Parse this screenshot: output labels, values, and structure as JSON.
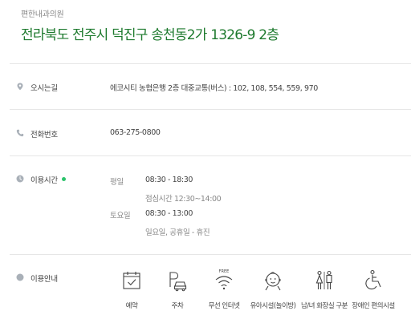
{
  "header": {
    "place_name": "편한내과의원",
    "address": "전라북도 전주시 덕진구 송천동2가 1326-9 2층"
  },
  "directions": {
    "label": "오시는길",
    "value": "에코시티 농협은행 2층 대중교통(버스) : 102, 108, 554, 559, 970"
  },
  "phone": {
    "label": "전화번호",
    "value": "063-275-0800"
  },
  "hours": {
    "label": "이용시간",
    "status_color": "#2bc36b",
    "weekday_label": "평일",
    "weekday_hours": "08:30 - 18:30",
    "weekday_break": "점심시간 12:30~14:00",
    "saturday_label": "토요일",
    "saturday_hours": "08:30 - 13:00",
    "closed_note": "일요일, 공휴일 - 휴진"
  },
  "amenities": {
    "label": "이용안내",
    "items": [
      {
        "icon": "calendar-check-icon",
        "label": "예약"
      },
      {
        "icon": "parking-car-icon",
        "label": "주차"
      },
      {
        "icon": "wifi-free-icon",
        "label": "무선 인터넷",
        "badge": "FREE"
      },
      {
        "icon": "baby-face-icon",
        "label": "유아시설(놀이방)"
      },
      {
        "icon": "gender-restroom-icon",
        "label": "남/녀 화장실 구분"
      },
      {
        "icon": "wheelchair-icon",
        "label": "장애인 편의시설"
      }
    ]
  },
  "colors": {
    "accent_green": "#1e7a2e",
    "icon_gray": "#a9b0b8"
  }
}
